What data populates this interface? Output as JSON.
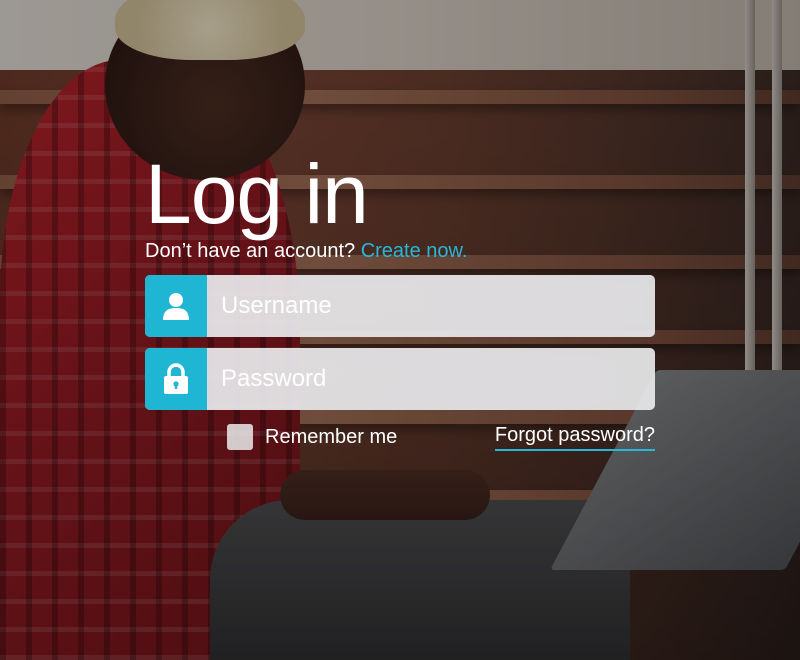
{
  "login": {
    "title": "Log in",
    "subtitle_text": "Don’t have an account? ",
    "create_link": "Create now.",
    "username_placeholder": "Username",
    "password_placeholder": "Password",
    "remember_label": "Remember me",
    "remember_checked": false,
    "forgot_link": "Forgot password?"
  },
  "icons": {
    "username": "user-icon",
    "password": "lock-icon"
  },
  "colors": {
    "accent": "#1eb6d3",
    "link": "#29b6d8",
    "field_bg": "#e8e8eb"
  }
}
